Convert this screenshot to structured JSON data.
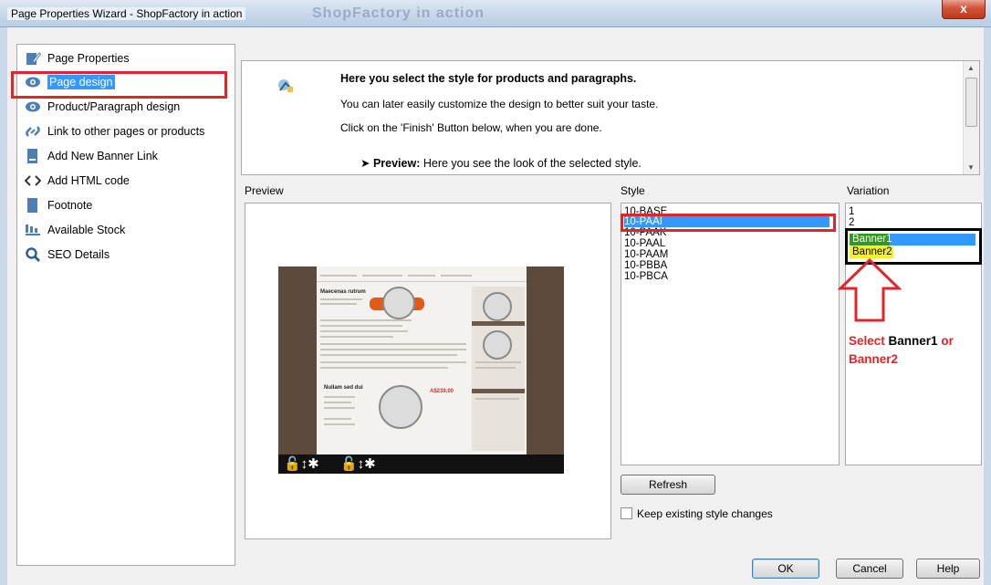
{
  "window": {
    "title": "Page Properties Wizard - ShopFactory in action",
    "ghost_title": "ShopFactory in action",
    "close_glyph": "x"
  },
  "nav": {
    "items": [
      {
        "label": "Page Properties",
        "icon": "pencil-page-icon"
      },
      {
        "label": "Page design",
        "icon": "eye-icon",
        "selected": true
      },
      {
        "label": "Product/Paragraph design",
        "icon": "eye-icon"
      },
      {
        "label": "Link to other pages or products",
        "icon": "link-icon"
      },
      {
        "label": "Add New Banner Link",
        "icon": "banner-icon"
      },
      {
        "label": "Add HTML code",
        "icon": "code-brackets-icon"
      },
      {
        "label": "Footnote",
        "icon": "footnote-icon"
      },
      {
        "label": "Available Stock",
        "icon": "stock-bars-icon"
      },
      {
        "label": "SEO Details",
        "icon": "search-icon"
      }
    ]
  },
  "description": {
    "heading": "Here you select the style for products and paragraphs.",
    "line1": "You can later easily customize the design to better suit your taste.",
    "line2": "Click on the 'Finish' Button below, when you are done.",
    "bullet_bold": "Preview:",
    "bullet_text": " Here you see the look of the selected style."
  },
  "labels": {
    "preview": "Preview",
    "style": "Style",
    "variation": "Variation"
  },
  "preview_thumb": {
    "heading": "Maecenas rutrum",
    "heading2": "Nullam sed dui",
    "price": "A$239.00",
    "bottom_glyphs": "🔓↕✱"
  },
  "style_list": {
    "items": [
      "10-BASE",
      "10-PAAI",
      "10-PAAK",
      "10-PAAL",
      "10-PAAM",
      "10-PBBA",
      "10-PBCA"
    ],
    "selected": "10-PAAI"
  },
  "variation_list": {
    "items": [
      "1",
      "2",
      "Banner1",
      "Banner2"
    ],
    "selected": "Banner1"
  },
  "annotation": {
    "select": "Select",
    "banner1": "Banner1",
    "or": "or",
    "banner2": "Banner2"
  },
  "buttons": {
    "refresh": "Refresh",
    "ok": "OK",
    "cancel": "Cancel",
    "help": "Help"
  },
  "checkbox": {
    "label": "Keep existing style changes",
    "checked": false
  },
  "colors": {
    "selection": "#3399ff",
    "annotation_red": "#e0262b",
    "banner1_green": "#2e9a1e",
    "banner2_yellow": "#f4f21d"
  }
}
